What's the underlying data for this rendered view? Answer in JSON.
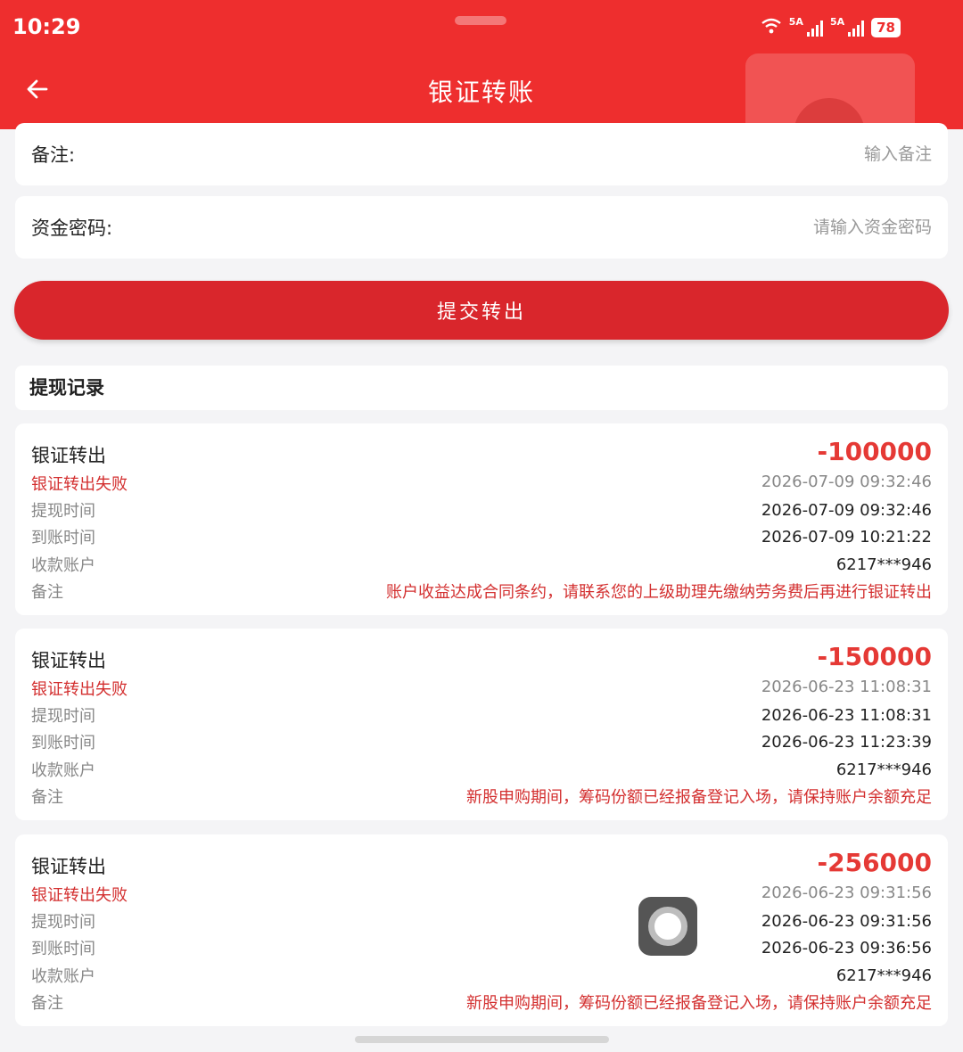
{
  "status_bar": {
    "time": "10:29",
    "network_1": "5A",
    "network_2": "5A",
    "battery": "78"
  },
  "header": {
    "title": "银证转账",
    "back_icon": "arrow-left-icon"
  },
  "form": {
    "remark": {
      "label": "备注:",
      "placeholder": "输入备注",
      "value": ""
    },
    "fund_password": {
      "label": "资金密码:",
      "placeholder": "请输入资金密码",
      "value": ""
    },
    "submit_label": "提交转出"
  },
  "records": {
    "title": "提现记录",
    "labels": {
      "withdraw_time": "提现时间",
      "arrival_time": "到账时间",
      "account": "收款账户",
      "note": "备注"
    },
    "items": [
      {
        "type": "银证转出",
        "amount": "-100000",
        "status": "银证转出失败",
        "datetime": "2026-07-09 09:32:46",
        "withdraw_time": "2026-07-09 09:32:46",
        "arrival_time": "2026-07-09 10:21:22",
        "account": "6217***946",
        "note": "账户收益达成合同条约，请联系您的上级助理先缴纳劳务费后再进行银证转出"
      },
      {
        "type": "银证转出",
        "amount": "-150000",
        "status": "银证转出失败",
        "datetime": "2026-06-23 11:08:31",
        "withdraw_time": "2026-06-23 11:08:31",
        "arrival_time": "2026-06-23 11:23:39",
        "account": "6217***946",
        "note": "新股申购期间，筹码份额已经报备登记入场，请保持账户余额充足"
      },
      {
        "type": "银证转出",
        "amount": "-256000",
        "status": "银证转出失败",
        "datetime": "2026-06-23 09:31:56",
        "withdraw_time": "2026-06-23 09:31:56",
        "arrival_time": "2026-06-23 09:36:56",
        "account": "6217***946",
        "note": "新股申购期间，筹码份额已经报备登记入场，请保持账户余额充足"
      }
    ]
  },
  "colors": {
    "header_bg": "#ee2e2e",
    "submit_bg": "#d9262c",
    "amount": "#e53935",
    "failed_status": "#d32f2f"
  }
}
